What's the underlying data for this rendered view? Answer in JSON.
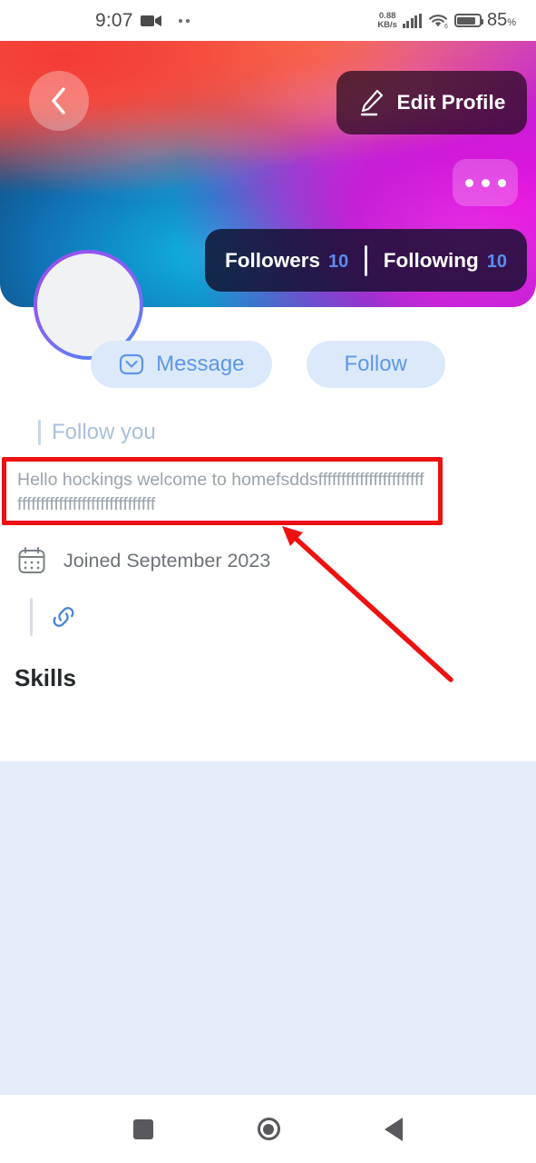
{
  "status_bar": {
    "time": "9:07",
    "camera_icon": "video-camera-icon",
    "network_speed_value": "0.88",
    "network_speed_unit": "KB/s",
    "signal_icon": "cellular-signal-icon",
    "wifi_icon": "wifi-6-icon",
    "wifi_generation": "6",
    "battery_icon": "battery-icon",
    "battery_percent": "85",
    "battery_percent_symbol": "%"
  },
  "banner": {
    "back_icon": "chevron-left-icon",
    "edit_profile_label": "Edit Profile",
    "edit_icon": "pencil-edit-icon",
    "more_icon": "more-horizontal-icon",
    "stats": {
      "followers_label": "Followers",
      "followers_count": "10",
      "following_label": "Following",
      "following_count": "10"
    }
  },
  "profile": {
    "avatar": "avatar-placeholder",
    "actions": [
      {
        "label": "Message",
        "icon": "message-chat-icon"
      },
      {
        "label": "Follow",
        "icon": ""
      }
    ],
    "follow_you_label": "Follow you",
    "bio": "Hello hockings welcome to homefsddsfffffffffffffffffffffffffffffffffffffffffffffffffffff",
    "joined_label": "Joined September 2023",
    "calendar_icon": "calendar-icon",
    "link_icon": "link-chain-icon",
    "skills_heading": "Skills"
  },
  "nav_bar": {
    "recents_icon": "square-recents-icon",
    "home_icon": "circle-home-icon",
    "back_icon": "triangle-back-icon"
  },
  "annotations": {
    "highlight_color": "#ee1111",
    "arrow_color": "#ee1111",
    "highlight_target": "bio-text"
  },
  "colors": {
    "accent_blue": "#5e97e8",
    "pill_bg": "#dce9fb",
    "panel_bg": "#e5ecf9",
    "muted_text": "#9aa3ad"
  }
}
